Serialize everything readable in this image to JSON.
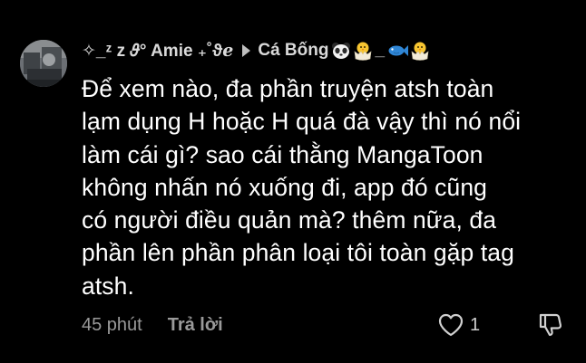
{
  "comment": {
    "author": "✧_ᶻ z 𝜗° Amie ₊˚ϑℯ",
    "reply_to": "Cá Bống",
    "reply_to_emojis": [
      "panda-face-icon",
      "hatching-chick-icon",
      "fish-icon",
      "hatching-chick-icon"
    ],
    "text": "Để xem nào, đa phần truyện atsh toàn\nlạm dụng H hoặc H quá đà vậy thì nó nổi\nlàm cái gì? sao cái thằng MangaToon\nkhông nhấn nó xuống đi, app đó cũng\ncó người điều quản mà? thêm nữa, đa\nphần lên phần phân loại tôi toàn gặp tag\natsh.",
    "timestamp": "45 phút",
    "reply_label": "Trả lời",
    "like_count": "1"
  },
  "colors": {
    "background": "#000000",
    "text": "#ffffff",
    "muted": "#9a9a9a"
  }
}
